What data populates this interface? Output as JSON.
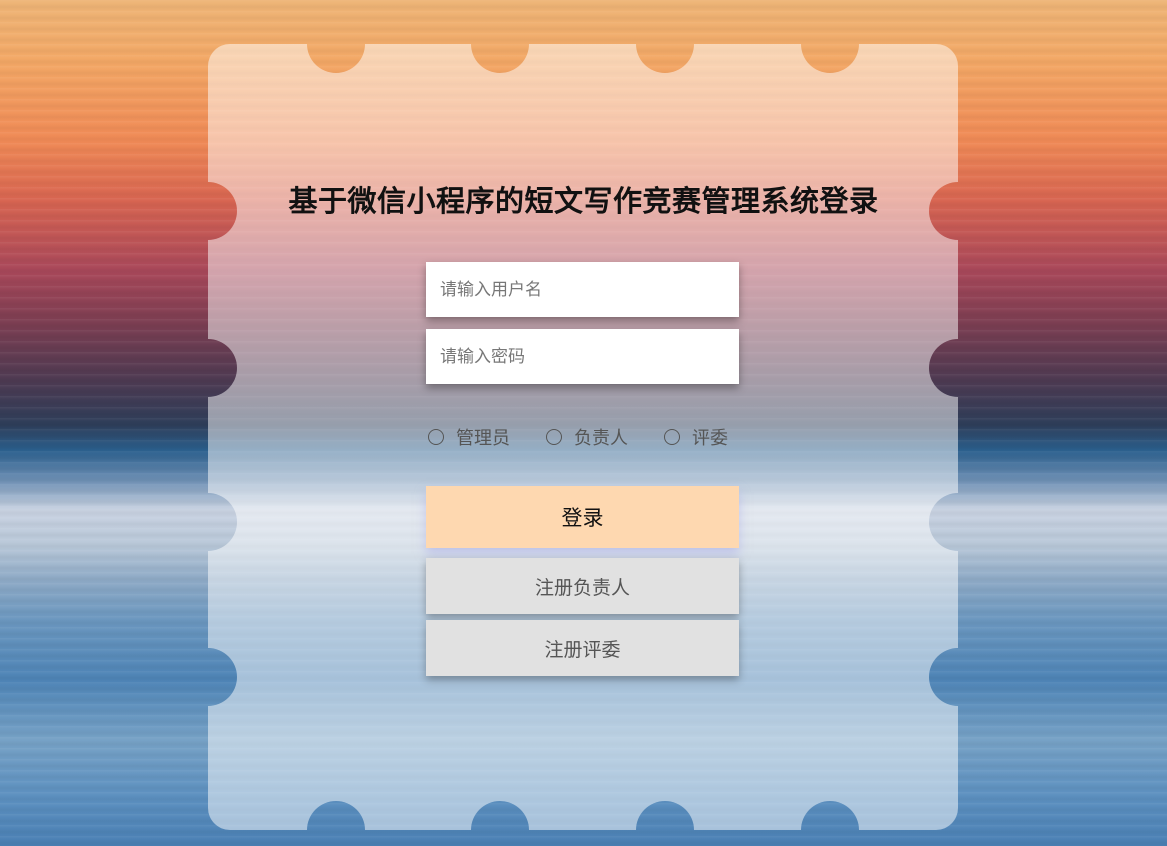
{
  "title": "基于微信小程序的短文写作竞赛管理系统登录",
  "username": {
    "placeholder": "请输入用户名",
    "value": ""
  },
  "password": {
    "placeholder": "请输入密码",
    "value": ""
  },
  "roles": [
    {
      "label": "管理员",
      "selected": false
    },
    {
      "label": "负责人",
      "selected": false
    },
    {
      "label": "评委",
      "selected": false
    }
  ],
  "buttons": {
    "login": "登录",
    "register_leader": "注册负责人",
    "register_judge": "注册评委"
  },
  "colors": {
    "login_button": "#fed8b0",
    "register_button": "#e1e1e1",
    "panel": "rgba(255,255,255,0.5)"
  }
}
